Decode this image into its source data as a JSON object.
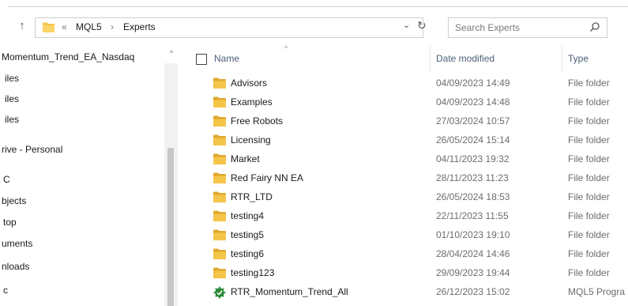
{
  "address_bar": {
    "overflow": "«",
    "crumbs": [
      "MQL5",
      "Experts"
    ],
    "separator": "›",
    "dropdown": "⌄",
    "refresh": "↻"
  },
  "search": {
    "placeholder": "Search Experts",
    "value": ""
  },
  "nav": {
    "items": [
      "Momentum_Trend_EA_Nasdaq",
      "iles",
      "iles",
      "iles",
      "rive - Personal",
      "C",
      "bjects",
      "top",
      "uments",
      "nloads",
      "c"
    ]
  },
  "columns": {
    "name": "Name",
    "date": "Date modified",
    "type": "Type"
  },
  "files": [
    {
      "name": "Advisors",
      "date": "04/09/2023 14:49",
      "type": "File folder",
      "icon": "folder-icon"
    },
    {
      "name": "Examples",
      "date": "04/09/2023 14:48",
      "type": "File folder",
      "icon": "folder-icon"
    },
    {
      "name": "Free Robots",
      "date": "27/03/2024 10:57",
      "type": "File folder",
      "icon": "folder-icon"
    },
    {
      "name": "Licensing",
      "date": "26/05/2024 15:14",
      "type": "File folder",
      "icon": "folder-icon"
    },
    {
      "name": "Market",
      "date": "04/11/2023 19:32",
      "type": "File folder",
      "icon": "folder-icon"
    },
    {
      "name": "Red Fairy NN  EA",
      "date": "28/11/2023 11:23",
      "type": "File folder",
      "icon": "folder-icon"
    },
    {
      "name": "RTR_LTD",
      "date": "26/05/2024 18:53",
      "type": "File folder",
      "icon": "folder-icon"
    },
    {
      "name": "testing4",
      "date": "22/11/2023 11:55",
      "type": "File folder",
      "icon": "folder-icon"
    },
    {
      "name": "testing5",
      "date": "01/10/2023 19:10",
      "type": "File folder",
      "icon": "folder-icon"
    },
    {
      "name": "testing6",
      "date": "28/04/2024 14:46",
      "type": "File folder",
      "icon": "folder-icon"
    },
    {
      "name": "testing123",
      "date": "29/09/2023 19:44",
      "type": "File folder",
      "icon": "folder-icon"
    },
    {
      "name": "RTR_Momentum_Trend_All",
      "date": "26/12/2023 15:02",
      "type": "MQL5 Progra",
      "icon": "mql5-program-icon"
    }
  ],
  "colors": {
    "folder": "#f5c54a",
    "folder_dark": "#e0a82e",
    "mql5_icon": "#2e8b3a",
    "header_text": "#4c607a"
  }
}
